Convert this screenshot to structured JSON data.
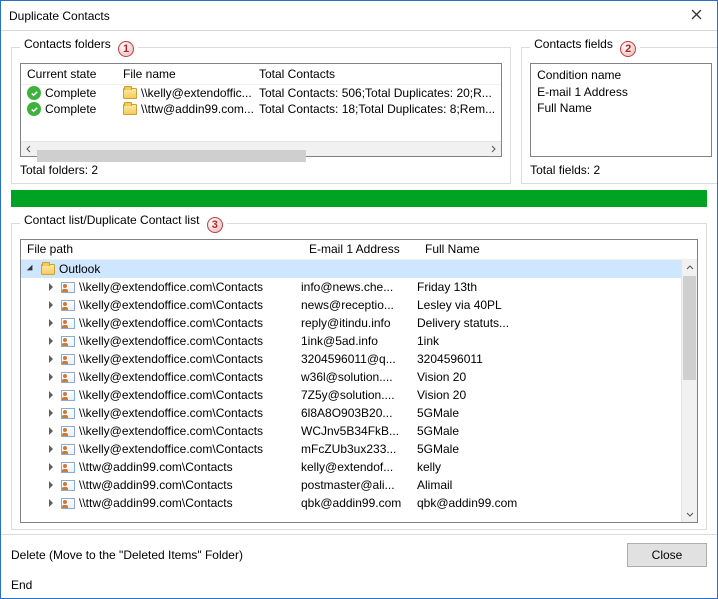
{
  "window": {
    "title": "Duplicate Contacts"
  },
  "folders_section": {
    "legend": "Contacts folders",
    "badge": "1",
    "headers": {
      "state": "Current state",
      "file": "File name",
      "total": "Total Contacts"
    },
    "rows": [
      {
        "state": "Complete",
        "file": "\\\\kelly@extendoffic...",
        "total": "Total Contacts: 506;Total Duplicates: 20;R..."
      },
      {
        "state": "Complete",
        "file": "\\\\ttw@addin99.com...",
        "total": "Total Contacts: 18;Total Duplicates: 8;Rem..."
      }
    ],
    "footer": "Total folders:  2"
  },
  "fields_section": {
    "legend": "Contacts fields",
    "badge": "2",
    "header": "Condition name",
    "items": [
      "E-mail 1 Address",
      "Full Name"
    ],
    "footer": "Total fields:  2"
  },
  "list_section": {
    "legend": "Contact list/Duplicate Contact list",
    "badge": "3",
    "headers": {
      "path": "File path",
      "email": "E-mail 1 Address",
      "name": "Full Name"
    },
    "root": {
      "label": "Outlook"
    },
    "rows": [
      {
        "path": "\\\\kelly@extendoffice.com\\Contacts",
        "email": "info@news.che...",
        "name": "Friday 13th"
      },
      {
        "path": "\\\\kelly@extendoffice.com\\Contacts",
        "email": "news@receptio...",
        "name": "Lesley via 40PL"
      },
      {
        "path": "\\\\kelly@extendoffice.com\\Contacts",
        "email": "reply@itindu.info",
        "name": "Delivery statuts..."
      },
      {
        "path": "\\\\kelly@extendoffice.com\\Contacts",
        "email": "1ink@5ad.info",
        "name": "1ink"
      },
      {
        "path": "\\\\kelly@extendoffice.com\\Contacts",
        "email": "3204596011@q...",
        "name": "3204596011"
      },
      {
        "path": "\\\\kelly@extendoffice.com\\Contacts",
        "email": "w36l@solution....",
        "name": "Vision 20"
      },
      {
        "path": "\\\\kelly@extendoffice.com\\Contacts",
        "email": "7Z5y@solution....",
        "name": "Vision 20"
      },
      {
        "path": "\\\\kelly@extendoffice.com\\Contacts",
        "email": "6l8A8O903B20...",
        "name": "5GMale"
      },
      {
        "path": "\\\\kelly@extendoffice.com\\Contacts",
        "email": "WCJnv5B34FkB...",
        "name": "5GMale"
      },
      {
        "path": "\\\\kelly@extendoffice.com\\Contacts",
        "email": "mFcZUb3ux233...",
        "name": "5GMale"
      },
      {
        "path": "\\\\ttw@addin99.com\\Contacts",
        "email": "kelly@extendof...",
        "name": "kelly"
      },
      {
        "path": "\\\\ttw@addin99.com\\Contacts",
        "email": "postmaster@ali...",
        "name": "Alimail"
      },
      {
        "path": "\\\\ttw@addin99.com\\Contacts",
        "email": "qbk@addin99.com",
        "name": "qbk@addin99.com"
      }
    ]
  },
  "footer": {
    "text": "Delete (Move to the \"Deleted Items\" Folder)",
    "close": "Close"
  },
  "end": "End"
}
